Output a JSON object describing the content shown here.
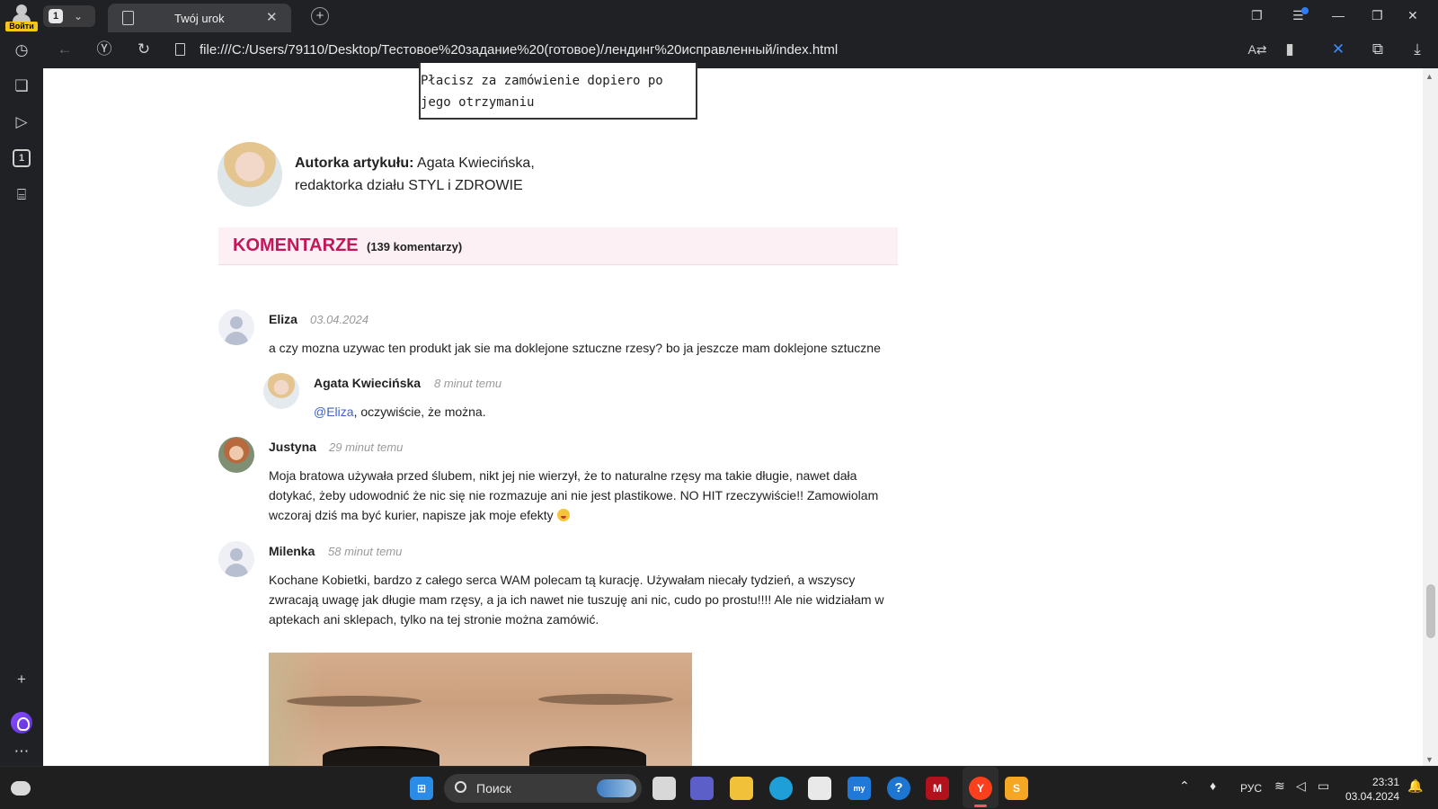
{
  "browser": {
    "login_label": "Войти",
    "tab_count": "1",
    "tab_title": "Twój urok",
    "url": "file:///C:/Users/79110/Desktop/Тестовое%20задание%20(готовое)/лендинг%20исправленный/index.html",
    "sidebar_tab_count": "1"
  },
  "page": {
    "payment_note": "Płacisz za zamówienie dopiero po jego otrzymaniu",
    "author": {
      "label": "Autorka artykułu:",
      "name": "Agata Kwiecińska,",
      "role": "redaktorka działu STYL i ZDROWIE"
    },
    "comments_header": {
      "title": "KOMENTARZE",
      "count": "(139 komentarzy)"
    },
    "comments": [
      {
        "name": "Eliza",
        "date": "03.04.2024",
        "text": "a czy mozna uzywac ten produkt jak sie ma doklejone sztuczne rzesy? bo ja jeszcze mam doklejone sztuczne"
      },
      {
        "name": "Agata Kwiecińska",
        "date": "8 minut temu",
        "mention": "@Eliza",
        "text": ", oczywiście, że można."
      },
      {
        "name": "Justyna",
        "date": "29 minut temu",
        "text": "Moja bratowa używała przed ślubem, nikt jej nie wierzył, że to naturalne rzęsy ma takie długie, nawet dała dotykać, żeby udowodnić że nic się nie rozmazuje ani nie jest plastikowe. NO HIT rzeczywiście!! Zamowiolam wczoraj dziś ma być kurier, napisze jak moje efekty"
      },
      {
        "name": "Milenka",
        "date": "58 minut temu",
        "text": "Kochane Kobietki, bardzo z całego serca WAM polecam tą kurację. Używałam niecały tydzień, a wszyscy zwracają uwagę jak długie mam rzęsy, a ja ich nawet nie tuszuję ani nic, cudo po prostu!!!! Ale nie widziałam w aptekach ani sklepach, tylko na tej stronie można zamówić."
      }
    ]
  },
  "taskbar": {
    "search_placeholder": "Поиск",
    "language": "РУС",
    "time": "23:31",
    "date": "03.04.2024"
  }
}
